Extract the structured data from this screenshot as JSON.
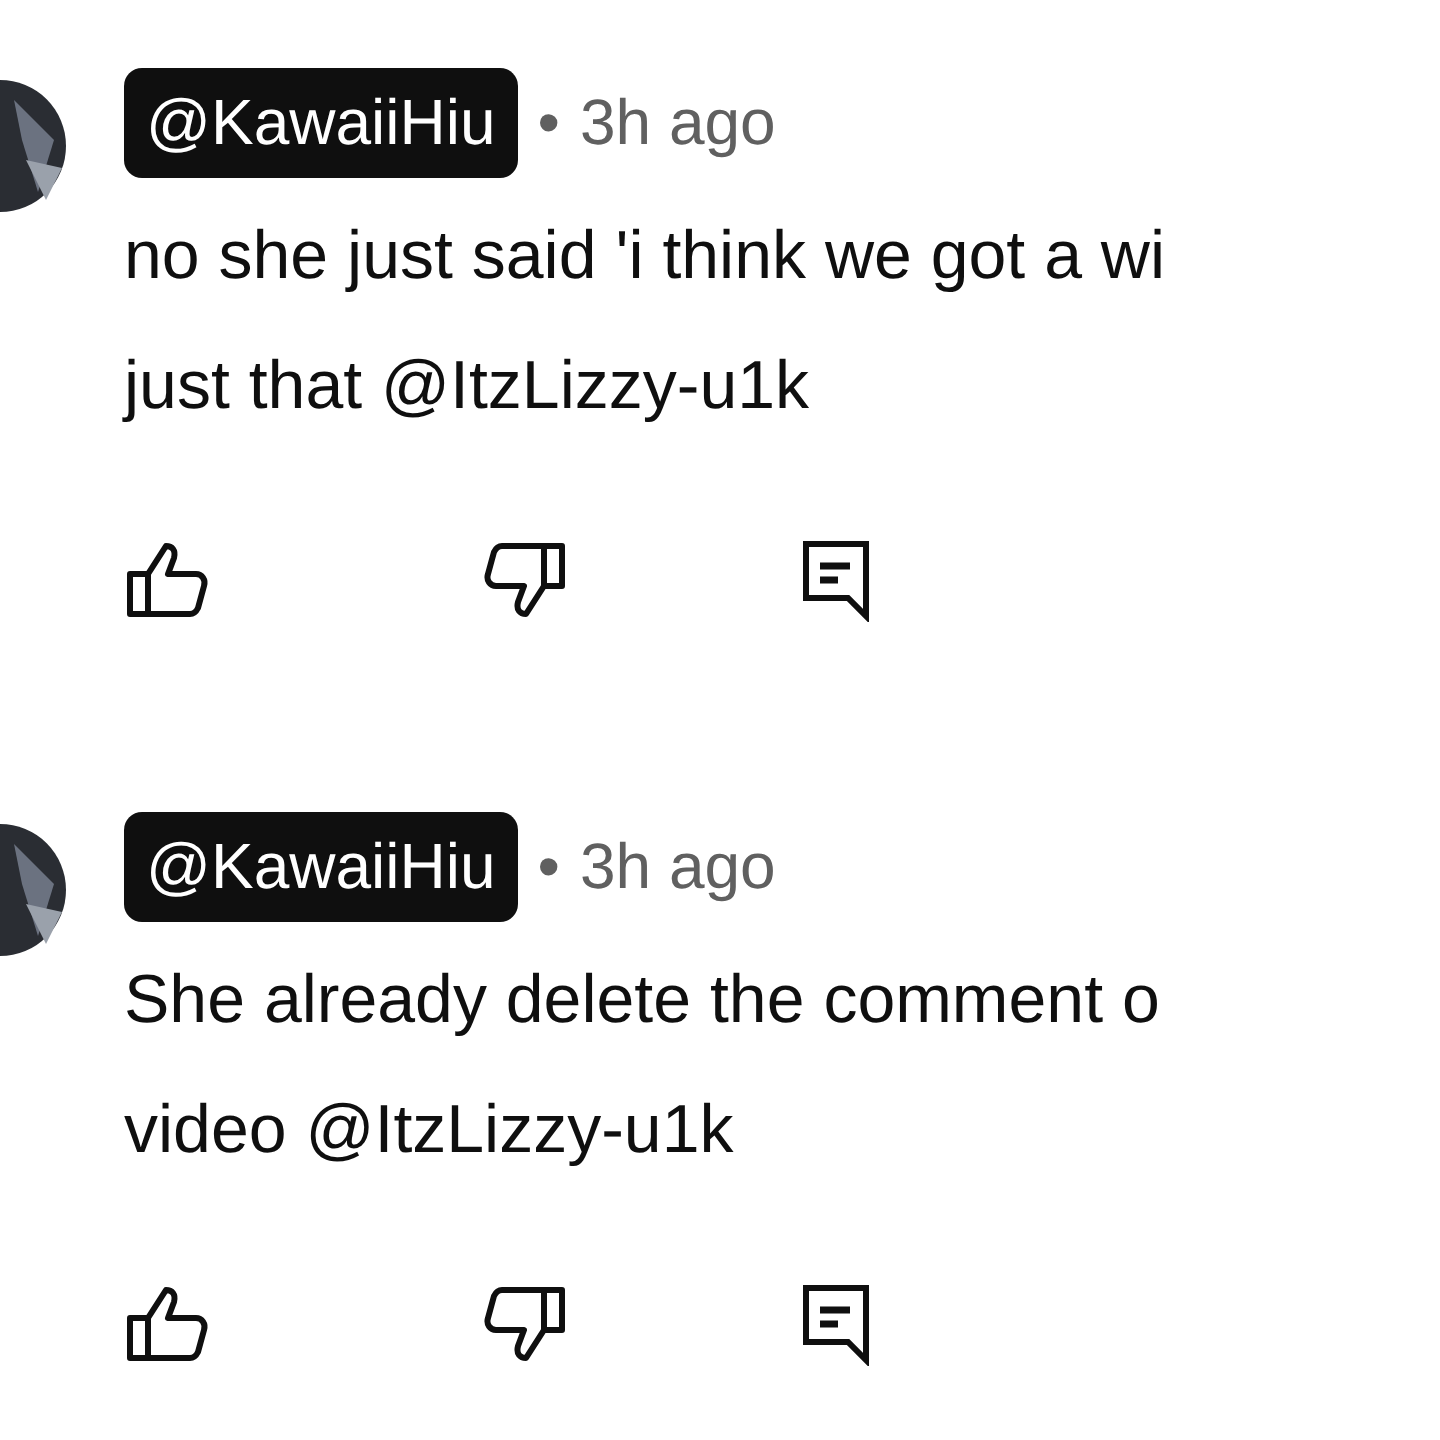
{
  "comments": [
    {
      "author": "@KawaiiHiu",
      "separator": "•",
      "time": "3h ago",
      "lines": [
        "no she just said 'i think we got a wi",
        "just that @ItzLizzy-u1k"
      ]
    },
    {
      "author": "@KawaiiHiu",
      "separator": "•",
      "time": "3h ago",
      "lines": [
        "She already delete the comment o",
        "video @ItzLizzy-u1k"
      ]
    }
  ]
}
